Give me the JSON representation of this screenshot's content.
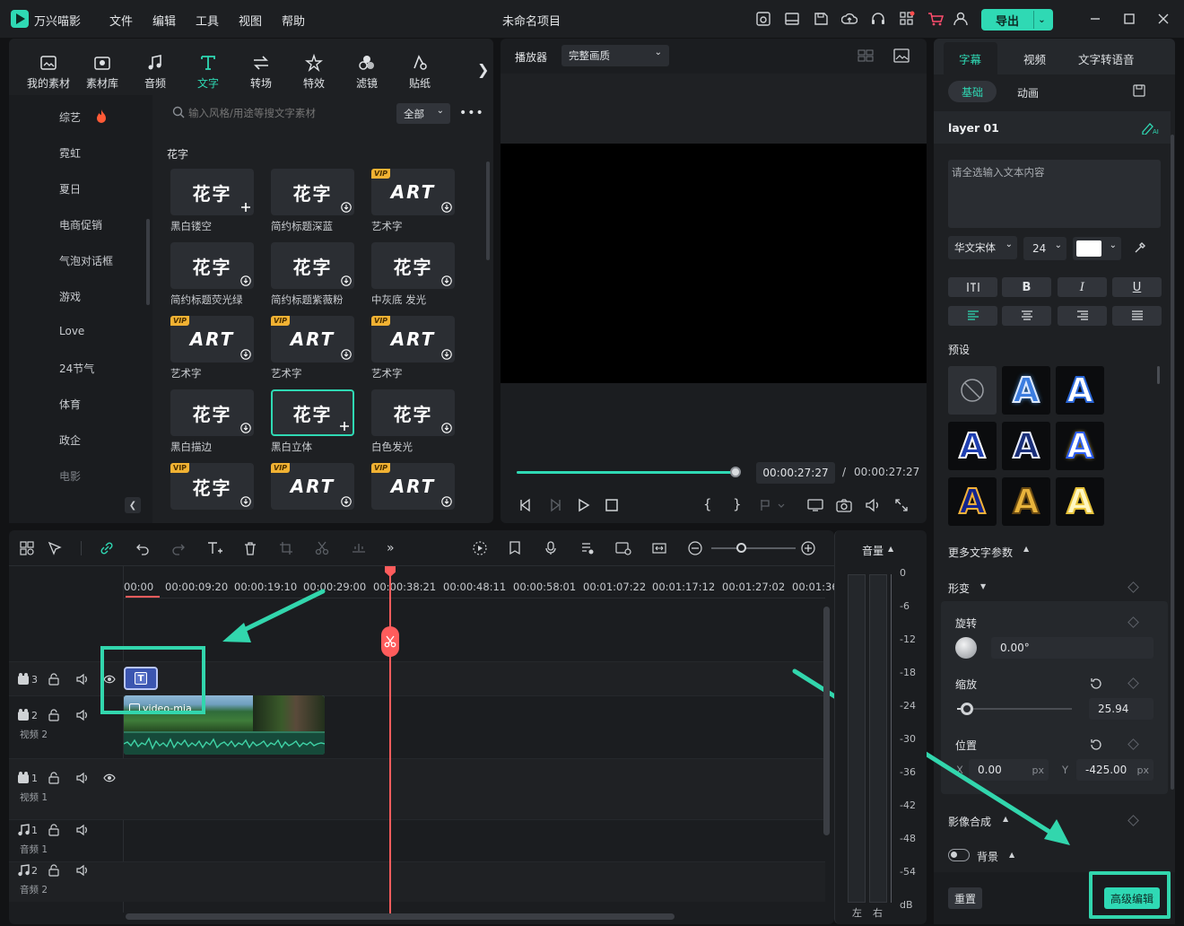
{
  "app": {
    "name": "万兴喵影",
    "project_title": "未命名项目"
  },
  "menu": [
    "文件",
    "编辑",
    "工具",
    "视图",
    "帮助"
  ],
  "export_label": "导出",
  "toolbar_tabs": [
    {
      "label": "我的素材",
      "icon": "my-media-icon"
    },
    {
      "label": "素材库",
      "icon": "stock-media-icon"
    },
    {
      "label": "音频",
      "icon": "audio-icon"
    },
    {
      "label": "文字",
      "icon": "text-icon",
      "active": true
    },
    {
      "label": "转场",
      "icon": "transition-icon"
    },
    {
      "label": "特效",
      "icon": "effects-icon"
    },
    {
      "label": "滤镜",
      "icon": "filters-icon"
    },
    {
      "label": "贴纸",
      "icon": "stickers-icon"
    }
  ],
  "search": {
    "placeholder": "输入风格/用途等搜文字素材",
    "filter": "全部"
  },
  "categories": [
    "综艺",
    "霓虹",
    "夏日",
    "电商促销",
    "气泡对话框",
    "游戏",
    "Love",
    "24节气",
    "体育",
    "政企",
    "电影"
  ],
  "section_title": "花字",
  "templates": [
    {
      "label": "黑白镂空",
      "text": "花字",
      "vip": false
    },
    {
      "label": "简约标题深蓝",
      "text": "花字",
      "vip": false
    },
    {
      "label": "艺术字",
      "text": "ART",
      "vip": true
    },
    {
      "label": "简约标题荧光绿",
      "text": "花字",
      "vip": false
    },
    {
      "label": "简约标题紫薇粉",
      "text": "花字",
      "vip": false
    },
    {
      "label": "中灰底 发光",
      "text": "花字",
      "vip": false
    },
    {
      "label": "艺术字",
      "text": "ART",
      "vip": true
    },
    {
      "label": "艺术字",
      "text": "ART",
      "vip": true
    },
    {
      "label": "艺术字",
      "text": "ART",
      "vip": true
    },
    {
      "label": "黑白描边",
      "text": "花字",
      "vip": false
    },
    {
      "label": "黑白立体",
      "text": "花字",
      "vip": false,
      "selected": true
    },
    {
      "label": "白色发光",
      "text": "花字",
      "vip": false
    },
    {
      "label": "",
      "text": "花字",
      "vip": true
    },
    {
      "label": "",
      "text": "ART",
      "vip": true
    },
    {
      "label": "",
      "text": "ART",
      "vip": true
    }
  ],
  "player": {
    "label": "播放器",
    "quality": "完整画质",
    "current_time": "00:00:27:27",
    "separator": "/",
    "total_time": "00:00:27:27",
    "progress": 1.0
  },
  "right_panel": {
    "tabs": [
      "字幕",
      "视频",
      "文字转语音"
    ],
    "subtabs": [
      "基础",
      "动画"
    ],
    "layer_name": "layer 01",
    "text_placeholder": "请全选输入文本内容",
    "font": "华文宋体",
    "font_size": "24",
    "text_color": "#ffffff",
    "style_buttons": [
      "B",
      "I",
      "U"
    ],
    "presets_label": "预设",
    "more_params": "更多文字参数",
    "transform": "形变",
    "rotate_label": "旋转",
    "rotate_value": "0.00°",
    "scale_label": "缩放",
    "scale_value": "25.94",
    "position_label": "位置",
    "x_label": "X",
    "x_value": "0.00",
    "y_label": "Y",
    "y_value": "-425.00",
    "unit": "px",
    "compositing": "影像合成",
    "background": "背景",
    "reset": "重置",
    "advanced": "高级编辑"
  },
  "timeline": {
    "ruler": [
      "00:00",
      "00:00:09:20",
      "00:00:19:10",
      "00:00:29:00",
      "00:00:38:21",
      "00:00:48:11",
      "00:00:58:01",
      "00:01:07:22",
      "00:01:17:12",
      "00:01:27:02",
      "00:01:36"
    ],
    "tracks": [
      {
        "num": "3",
        "name": ""
      },
      {
        "num": "2",
        "name": "视频 2"
      },
      {
        "num": "1",
        "name": "视频 1"
      },
      {
        "num": "1",
        "name": "音频 1"
      },
      {
        "num": "2",
        "name": "音频 2"
      }
    ],
    "clip_name": "video-mia"
  },
  "volume": {
    "label": "音量",
    "scale": [
      "0",
      "-6",
      "-12",
      "-18",
      "-24",
      "-30",
      "-36",
      "-42",
      "-48",
      "-54",
      "dB"
    ],
    "left": "左",
    "right": "右"
  },
  "colors": {
    "accent": "#2fd9b4",
    "playhead": "#ff5c5c",
    "vip": "#f1b233"
  }
}
